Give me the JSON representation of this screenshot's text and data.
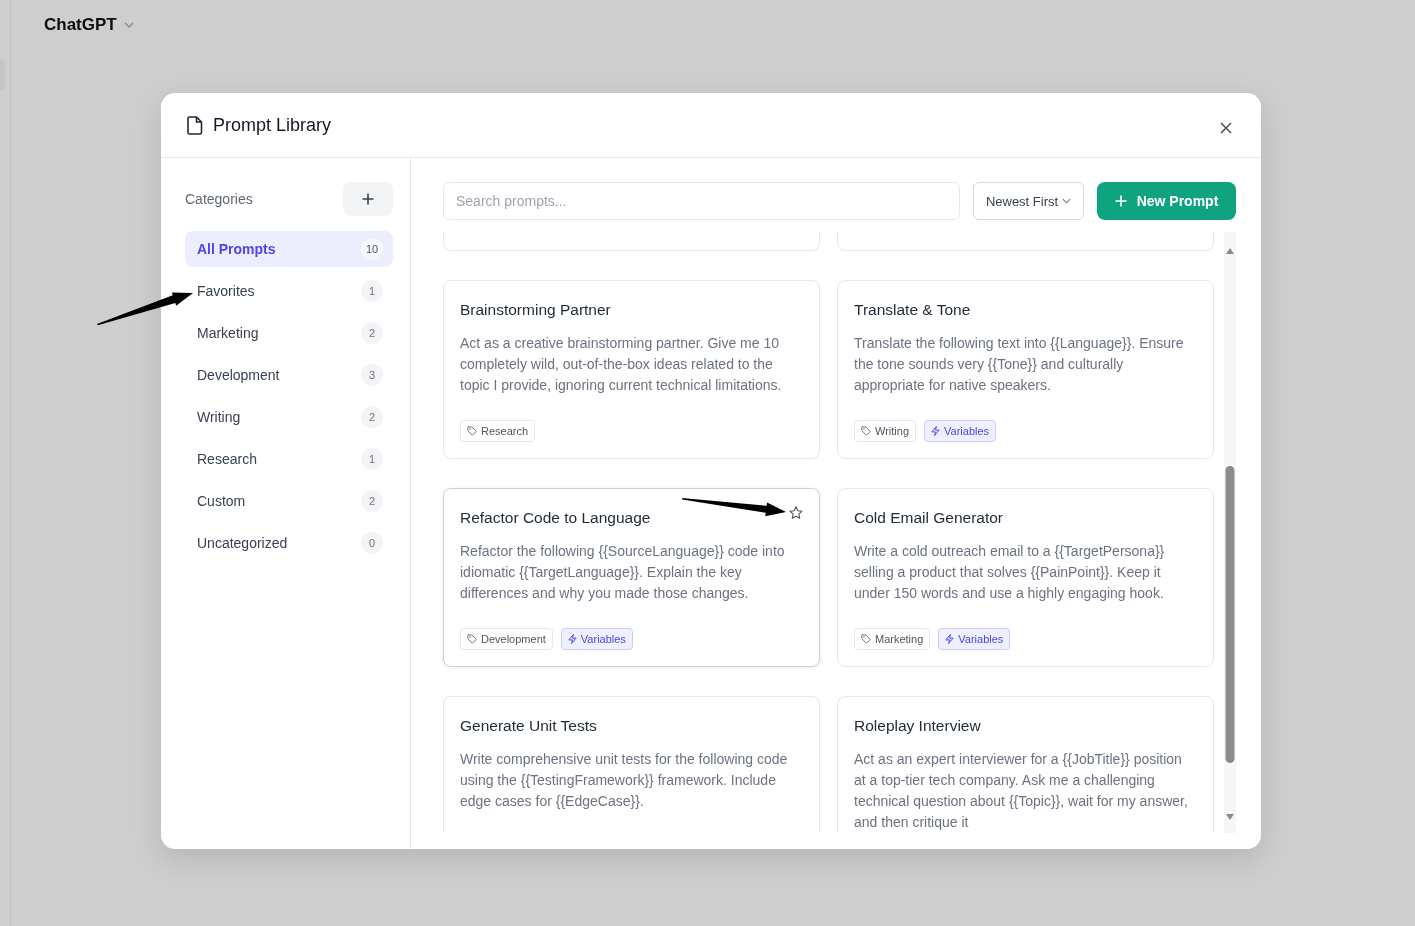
{
  "app_header": {
    "title": "ChatGPT"
  },
  "dialog": {
    "title": "Prompt Library"
  },
  "sidebar": {
    "heading": "Categories",
    "categories": [
      {
        "label": "All Prompts",
        "count": "10",
        "selected": true
      },
      {
        "label": "Favorites",
        "count": "1",
        "selected": false
      },
      {
        "label": "Marketing",
        "count": "2",
        "selected": false
      },
      {
        "label": "Development",
        "count": "3",
        "selected": false
      },
      {
        "label": "Writing",
        "count": "2",
        "selected": false
      },
      {
        "label": "Research",
        "count": "1",
        "selected": false
      },
      {
        "label": "Custom",
        "count": "2",
        "selected": false
      },
      {
        "label": "Uncategorized",
        "count": "0",
        "selected": false
      }
    ]
  },
  "toolbar": {
    "search": {
      "placeholder": "Search prompts..."
    },
    "sort": {
      "value": "Newest First"
    },
    "new_button": {
      "label": "New Prompt"
    }
  },
  "prompts": [
    {
      "title": "Brainstorming Partner",
      "description": "Act as a creative brainstorming partner. Give me 10 completely wild, out-of-the-box ideas related to the topic I provide, ignoring current technical limitations.",
      "hovered": false,
      "tags": [
        {
          "kind": "category",
          "label": "Research"
        }
      ]
    },
    {
      "title": "Translate & Tone",
      "description": "Translate the following text into {{Language}}. Ensure the tone sounds very {{Tone}} and culturally appropriate for native speakers.",
      "hovered": false,
      "tags": [
        {
          "kind": "category",
          "label": "Writing"
        },
        {
          "kind": "variables",
          "label": "Variables"
        }
      ]
    },
    {
      "title": "Refactor Code to Language",
      "description": "Refactor the following {{SourceLanguage}} code into idiomatic {{TargetLanguage}}. Explain the key differences and why you made those changes.",
      "hovered": true,
      "tags": [
        {
          "kind": "category",
          "label": "Development"
        },
        {
          "kind": "variables",
          "label": "Variables"
        }
      ]
    },
    {
      "title": "Cold Email Generator",
      "description": "Write a cold outreach email to a {{TargetPersona}} selling a product that solves {{PainPoint}}. Keep it under 150 words and use a highly engaging hook.",
      "hovered": false,
      "tags": [
        {
          "kind": "category",
          "label": "Marketing"
        },
        {
          "kind": "variables",
          "label": "Variables"
        }
      ]
    },
    {
      "title": "Generate Unit Tests",
      "description": "Write comprehensive unit tests for the following code using the {{TestingFramework}} framework. Include edge cases for {{EdgeCase}}.",
      "hovered": false
    },
    {
      "title": "Roleplay Interview",
      "description": "Act as an expert interviewer for a {{JobTitle}} position at a top-tier tech company. Ask me a challenging technical question about {{Topic}}, wait for my answer, and then critique it",
      "hovered": false
    }
  ]
}
